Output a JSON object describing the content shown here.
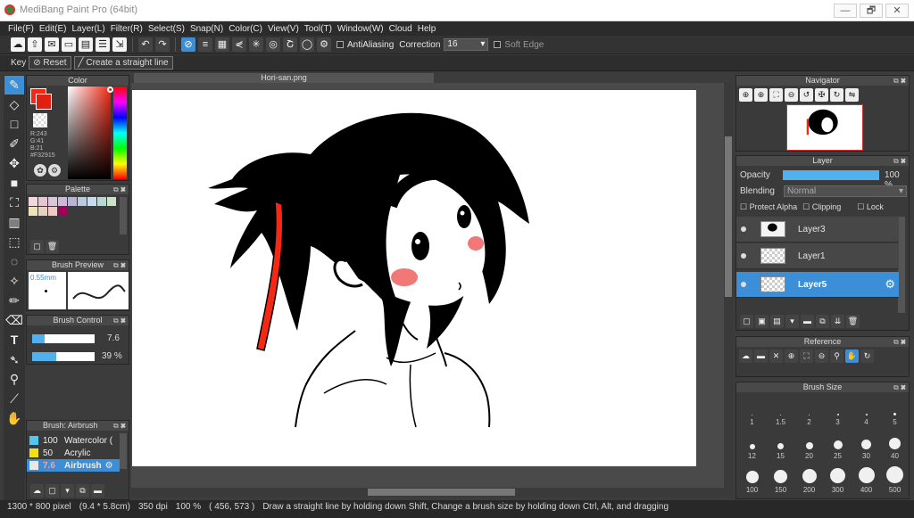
{
  "window": {
    "title": "MediBang Paint Pro (64bit)",
    "minimize": "—",
    "restore": "🗗",
    "close": "✕"
  },
  "menu": [
    "File(F)",
    "Edit(E)",
    "Layer(L)",
    "Filter(R)",
    "Select(S)",
    "Snap(N)",
    "Color(C)",
    "View(V)",
    "Tool(T)",
    "Window(W)",
    "Cloud",
    "Help"
  ],
  "toolbar": {
    "antialias_label": "AntiAliasing",
    "correction_label": "Correction",
    "correction_value": "16",
    "softedge_label": "Soft Edge"
  },
  "subbar": {
    "key_label": "Key",
    "reset_label": "Reset",
    "straight_label": "Create a straight line"
  },
  "color_panel": {
    "title": "Color",
    "rgb_r": "R:243",
    "rgb_g": "G:41",
    "rgb_b": "B:21",
    "hex": "#F32915",
    "main_color": "#f32915"
  },
  "palette": {
    "title": "Palette",
    "swatches": [
      "#f6d6de",
      "#e9c5d2",
      "#d9c7dc",
      "#cdb8d6",
      "#b9b3d6",
      "#bac8e2",
      "#c6dcea",
      "#b8d7d2",
      "#c9e3c4",
      "#ece4b5",
      "#e7d2c0",
      "#f0c8c6",
      "#a0005a"
    ]
  },
  "brush_preview": {
    "title": "Brush Preview",
    "size": "0.55mm"
  },
  "brush_control": {
    "title": "Brush Control",
    "size_value": "7.6",
    "opacity_value": "39 %",
    "size_fraction": 0.2,
    "opacity_fraction": 0.39
  },
  "brush_list": {
    "title": "Brush: Airbrush",
    "items": [
      {
        "size": "100",
        "name": "Watercolor (",
        "color": "#52c8f0"
      },
      {
        "size": "50",
        "name": "Acrylic",
        "color": "#f2e016"
      },
      {
        "size": "7.6",
        "name": "Airbrush",
        "color": "#e8e8e8"
      }
    ]
  },
  "canvas": {
    "tab_title": "Hori-san.png"
  },
  "navigator": {
    "title": "Navigator"
  },
  "layer_panel": {
    "title": "Layer",
    "opacity_label": "Opacity",
    "opacity_value": "100 %",
    "opacity_fraction": 1.0,
    "blending_label": "Blending",
    "blending_value": "Normal",
    "protect_alpha": "Protect Alpha",
    "clipping": "Clipping",
    "lock": "Lock",
    "layers": [
      {
        "name": "Layer3"
      },
      {
        "name": "Layer1"
      },
      {
        "name": "Layer5"
      }
    ]
  },
  "reference": {
    "title": "Reference"
  },
  "brush_size": {
    "title": "Brush Size",
    "sizes": [
      "1",
      "1.5",
      "2",
      "3",
      "4",
      "5",
      "12",
      "15",
      "20",
      "25",
      "30",
      "40",
      "100",
      "150",
      "200",
      "300",
      "400",
      "500"
    ]
  },
  "status": {
    "dims": "1300 * 800 pixel",
    "mm": "(9.4 * 5.8cm)",
    "dpi": "350 dpi",
    "zoom": "100 %",
    "coords": "( 456, 573 )",
    "hint": "Draw a straight line by holding down Shift, Change a brush size by holding down Ctrl, Alt, and dragging"
  }
}
